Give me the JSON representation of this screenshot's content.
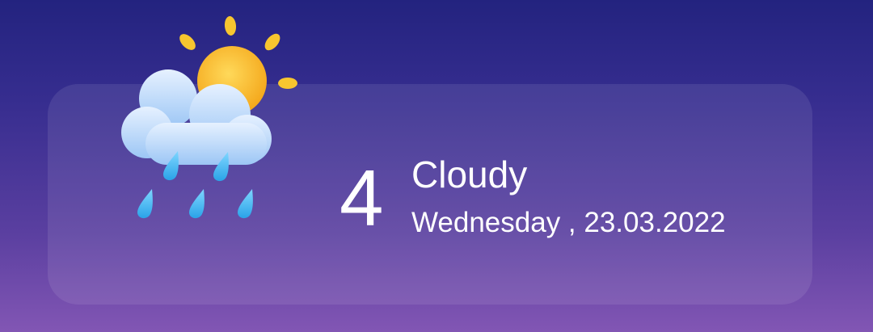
{
  "weather": {
    "temperature": "4",
    "condition": "Cloudy",
    "date_line": "Wednesday , 23.03.2022",
    "icon": "cloud-sun-rain-icon"
  },
  "colors": {
    "background_top": "#23237f",
    "background_bottom": "#8256b4",
    "sun": "#f7b928",
    "cloud": "#cfe3fb",
    "rain": "#48b9f2",
    "text": "#ffffff"
  }
}
